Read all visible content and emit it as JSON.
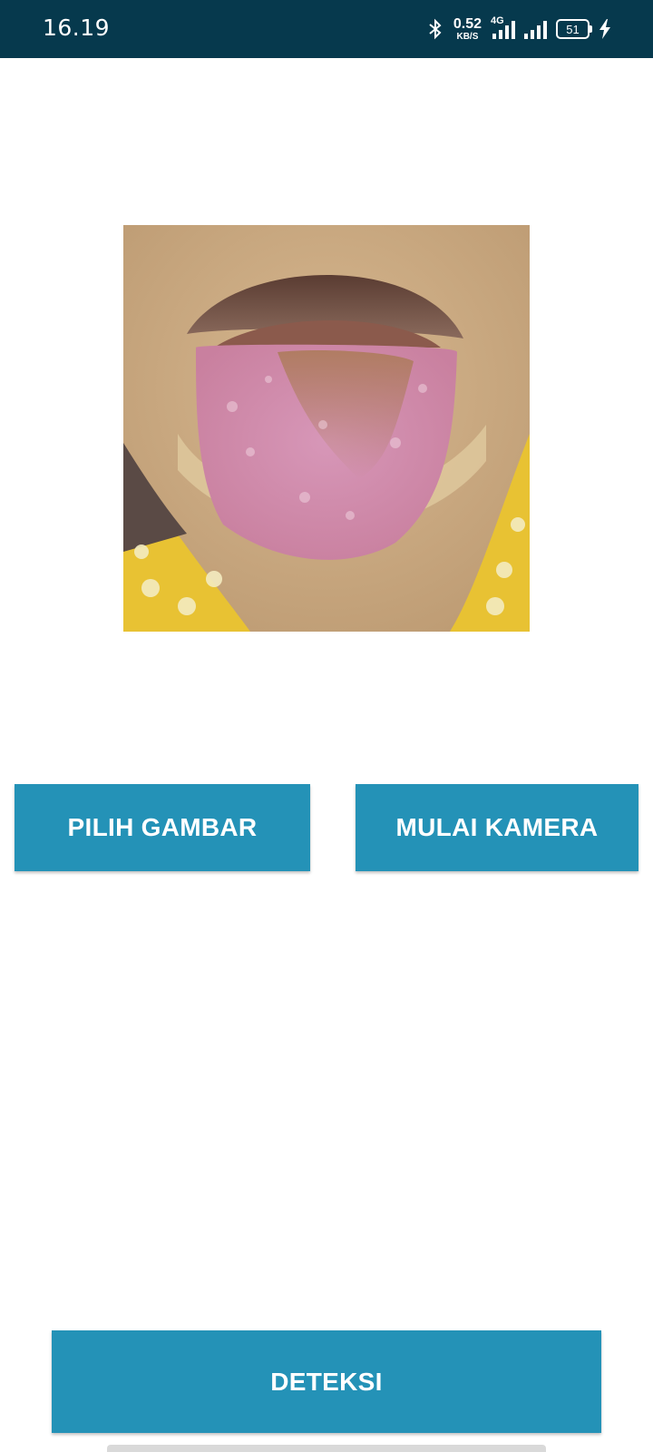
{
  "status_bar": {
    "time": "16.19",
    "net_speed_value": "0.52",
    "net_speed_unit": "KB/S",
    "network_type": "4G",
    "battery_level": "51",
    "icons": [
      "bluetooth-icon",
      "signal-4g-icon",
      "signal-icon",
      "battery-icon",
      "charging-icon"
    ]
  },
  "image": {
    "description_icon": "tongue-photo"
  },
  "buttons": {
    "pick_image": "PILIH GAMBAR",
    "start_camera": "MULAI KAMERA",
    "detect": "DETEKSI"
  },
  "colors": {
    "status_bar_bg": "#06394d",
    "button_bg": "#2492b7",
    "button_text": "#ffffff"
  }
}
